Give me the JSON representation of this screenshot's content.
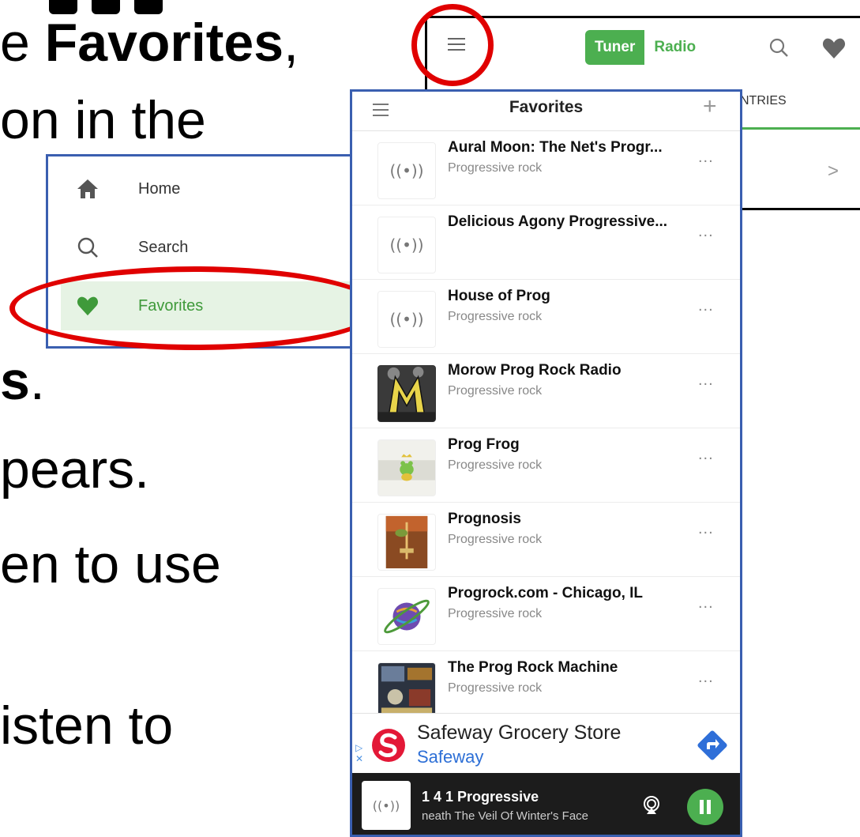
{
  "background_text": {
    "line1_prefix": "e ",
    "line1_bold": "Favorites",
    "line1_suffix": ",",
    "line2": "on in the",
    "line3_bold": "s",
    "line3_suffix": ".",
    "line4": "pears.",
    "line5": "en to use",
    "line6": "isten to"
  },
  "tuner_app": {
    "logo_tuner": "Tuner",
    "logo_radio": "Radio",
    "tab_partial": "NTRIES",
    "chevron": ">",
    "accent_color": "#4caf50"
  },
  "side_menu": {
    "items": [
      {
        "label": "Home",
        "icon": "home-icon"
      },
      {
        "label": "Search",
        "icon": "search-icon"
      },
      {
        "label": "Favorites",
        "icon": "heart-icon",
        "active": true
      }
    ]
  },
  "favorites": {
    "title": "Favorites",
    "add_label": "+",
    "more_label": "...",
    "stations": [
      {
        "name": "Aural Moon: The Net's Progr...",
        "genre": "Progressive rock",
        "thumb": "broadcast-icon"
      },
      {
        "name": "Delicious Agony Progressive...",
        "genre": "",
        "thumb": "broadcast-icon"
      },
      {
        "name": "House of Prog",
        "genre": "Progressive rock",
        "thumb": "broadcast-icon"
      },
      {
        "name": "Morow Prog Rock Radio",
        "genre": "Progressive rock",
        "thumb": "morow-logo"
      },
      {
        "name": "Prog Frog",
        "genre": "Progressive rock",
        "thumb": "frog-logo"
      },
      {
        "name": "Prognosis",
        "genre": "Progressive rock",
        "thumb": "prognosis-logo"
      },
      {
        "name": "Progrock.com - Chicago, IL",
        "genre": "Progressive rock",
        "thumb": "planet-logo"
      },
      {
        "name": "The Prog Rock Machine",
        "genre": "Progressive rock",
        "thumb": "machine-logo"
      }
    ]
  },
  "ad": {
    "title": "Safeway Grocery Store",
    "subtitle": "Safeway"
  },
  "player": {
    "title": "1 4 1 Progressive",
    "subtitle": "neath The Veil Of Winter's Face"
  },
  "colors": {
    "highlight_red": "#e00000",
    "frame_blue": "#3a5fb0",
    "green": "#4caf50"
  }
}
